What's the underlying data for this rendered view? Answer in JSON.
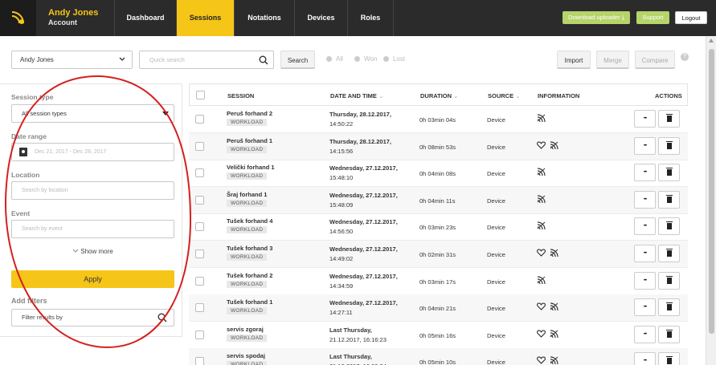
{
  "header": {
    "user_name": "Andy Jones",
    "user_sub": "Account",
    "tabs": [
      "Dashboard",
      "Sessions",
      "Notations",
      "Devices",
      "Roles"
    ],
    "active_tab": "Sessions",
    "download_label": "Download uploader",
    "support_label": "Support",
    "logout_label": "Logout",
    "accent_color": "#f5c518"
  },
  "search": {
    "user_select": "Andy Jones",
    "placeholder": "Quick search",
    "button": "Search",
    "radio": [
      "All",
      "Won",
      "Lost"
    ]
  },
  "actions": {
    "import": "Import",
    "merge": "Merge",
    "compare": "Compare",
    "help": "?"
  },
  "filters": {
    "session_type_label": "Session type",
    "session_type_value": "All session types",
    "date_label": "Date range",
    "date_value": "Dec 21, 2017 - Dec 28, 2017",
    "location_label": "Location",
    "location_placeholder": "Search by location",
    "event_label": "Event",
    "event_placeholder": "Search by event",
    "show_more": "Show more",
    "apply": "Apply",
    "add_filters": "Add filters",
    "filter_placeholder": "Filter results by"
  },
  "table": {
    "headers": {
      "session": "SESSION",
      "date": "DATE AND TIME",
      "duration": "DURATION",
      "source": "SOURCE",
      "information": "INFORMATION",
      "actions": "ACTIONS"
    },
    "rows": [
      {
        "name": "Peruš forhand 2",
        "tag": "WORKLOAD",
        "date": "Thursday, 28.12.2017,",
        "time": "14:50:22",
        "duration": "0h 03min 04s",
        "source": "Device",
        "heart": false
      },
      {
        "name": "Peruš forhand 1",
        "tag": "WORKLOAD",
        "date": "Thursday, 28.12.2017,",
        "time": "14:15:56",
        "duration": "0h 08min 53s",
        "source": "Device",
        "heart": true
      },
      {
        "name": "Velički forhand 1",
        "tag": "WORKLOAD",
        "date": "Wednesday, 27.12.2017,",
        "time": "15:48:10",
        "duration": "0h 04min 08s",
        "source": "Device",
        "heart": false
      },
      {
        "name": "Šraj forhand 1",
        "tag": "WORKLOAD",
        "date": "Wednesday, 27.12.2017,",
        "time": "15:48:09",
        "duration": "0h 04min 11s",
        "source": "Device",
        "heart": false
      },
      {
        "name": "Tušek forhand 4",
        "tag": "WORKLOAD",
        "date": "Wednesday, 27.12.2017,",
        "time": "14:56:50",
        "duration": "0h 03min 23s",
        "source": "Device",
        "heart": false
      },
      {
        "name": "Tušek forhand 3",
        "tag": "WORKLOAD",
        "date": "Wednesday, 27.12.2017,",
        "time": "14:49:02",
        "duration": "0h 02min 31s",
        "source": "Device",
        "heart": true
      },
      {
        "name": "Tušek forhand 2",
        "tag": "WORKLOAD",
        "date": "Wednesday, 27.12.2017,",
        "time": "14:34:59",
        "duration": "0h 03min 17s",
        "source": "Device",
        "heart": false
      },
      {
        "name": "Tušek forhand 1",
        "tag": "WORKLOAD",
        "date": "Wednesday, 27.12.2017,",
        "time": "14:27:11",
        "duration": "0h 04min 21s",
        "source": "Device",
        "heart": true
      },
      {
        "name": "servis zgoraj",
        "tag": "WORKLOAD",
        "date": "Last Thursday,",
        "time": "21.12.2017, 16:16:23",
        "duration": "0h 05min 16s",
        "source": "Device",
        "heart": true
      },
      {
        "name": "servis spodaj",
        "tag": "WORKLOAD",
        "date": "Last Thursday,",
        "time": "21.12.2017, 16:08:24",
        "duration": "0h 05min 10s",
        "source": "Device",
        "heart": true
      }
    ]
  }
}
